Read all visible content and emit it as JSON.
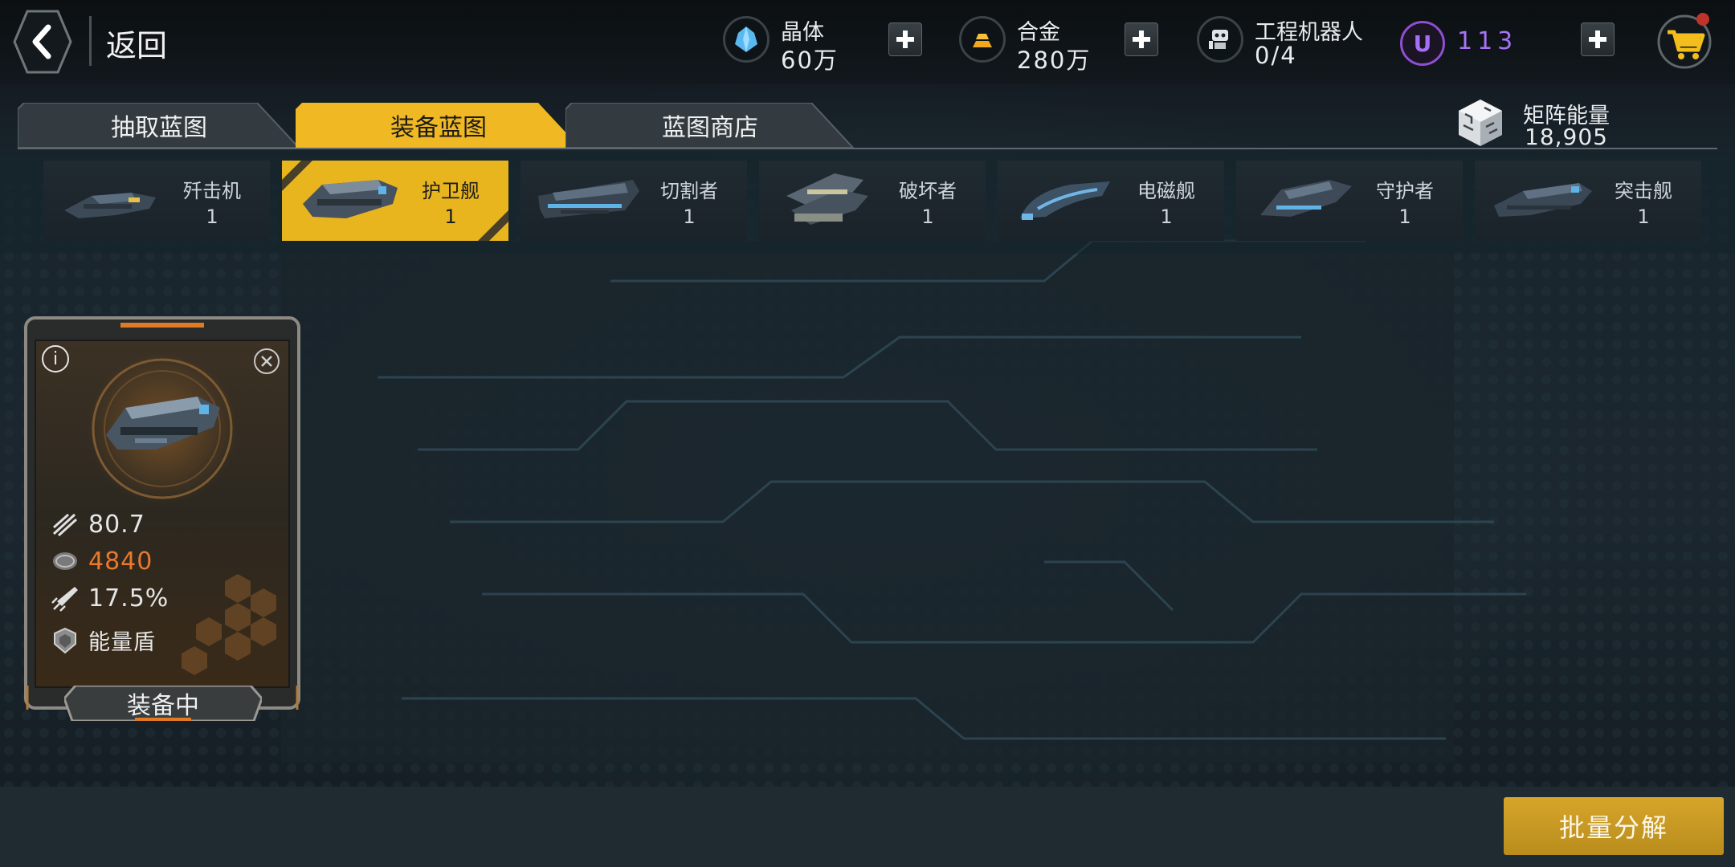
{
  "header": {
    "back_label": "返回",
    "resources": [
      {
        "label": "晶体",
        "value": "60万",
        "icon": "crystal-icon"
      },
      {
        "label": "合金",
        "value": "280万",
        "icon": "alloy-icon"
      },
      {
        "label": "工程机器人",
        "value": "0/4",
        "icon": "robot-icon"
      }
    ],
    "premium_value": "113",
    "premium_symbol": "U"
  },
  "tabs": [
    {
      "label": "抽取蓝图",
      "active": false
    },
    {
      "label": "装备蓝图",
      "active": true
    },
    {
      "label": "蓝图商店",
      "active": false
    }
  ],
  "matrix": {
    "label": "矩阵能量",
    "value": "18,905"
  },
  "ships": [
    {
      "name": "歼击机",
      "count": "1",
      "active": false
    },
    {
      "name": "护卫舰",
      "count": "1",
      "active": true
    },
    {
      "name": "切割者",
      "count": "1",
      "active": false
    },
    {
      "name": "破坏者",
      "count": "1",
      "active": false
    },
    {
      "name": "电磁舰",
      "count": "1",
      "active": false
    },
    {
      "name": "守护者",
      "count": "1",
      "active": false
    },
    {
      "name": "突击舰",
      "count": "1",
      "active": false
    }
  ],
  "blueprint": {
    "stats": [
      {
        "icon": "firepower-icon",
        "value": "80.7"
      },
      {
        "icon": "armor-icon",
        "value": "4840"
      },
      {
        "icon": "speed-icon",
        "value": "17.5%"
      },
      {
        "icon": "shield-icon",
        "value": "能量盾"
      }
    ],
    "status_label": "装备中"
  },
  "bulk_button": "批量分解",
  "colors": {
    "accent_gold": "#e9b51f",
    "premium_purple": "#a773f2",
    "stat_orange": "#e9792b"
  }
}
